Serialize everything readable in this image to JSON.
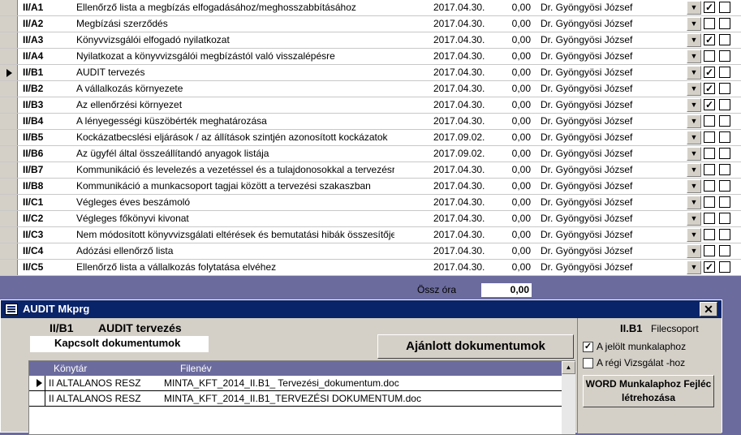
{
  "rows": [
    {
      "code": "II/A1",
      "title": "Ellenőrző lista a megbízás elfogadásához/meghosszabbításához",
      "date": "2017.04.30.",
      "hours": "0,00",
      "person": "Dr. Gyöngyösi József",
      "cb1": true,
      "cb2": false,
      "current": false
    },
    {
      "code": "II/A2",
      "title": "Megbízási szerződés",
      "date": "2017.04.30.",
      "hours": "0,00",
      "person": "Dr. Gyöngyösi József",
      "cb1": false,
      "cb2": false,
      "current": false
    },
    {
      "code": "II/A3",
      "title": "Könyvvizsgálói elfogadó nyilatkozat",
      "date": "2017.04.30.",
      "hours": "0,00",
      "person": "Dr. Gyöngyösi József",
      "cb1": true,
      "cb2": false,
      "current": false
    },
    {
      "code": "II/A4",
      "title": "Nyilatkozat a könyvvizsgálói megbízástól való visszalépésre",
      "date": "2017.04.30.",
      "hours": "0,00",
      "person": "Dr. Gyöngyösi József",
      "cb1": false,
      "cb2": false,
      "current": false
    },
    {
      "code": "II/B1",
      "title": "AUDIT tervezés",
      "date": "2017.04.30.",
      "hours": "0,00",
      "person": "Dr. Gyöngyösi József",
      "cb1": true,
      "cb2": false,
      "current": true
    },
    {
      "code": "II/B2",
      "title": "A vállalkozás környezete",
      "date": "2017.04.30.",
      "hours": "0,00",
      "person": "Dr. Gyöngyösi József",
      "cb1": true,
      "cb2": false,
      "current": false
    },
    {
      "code": "II/B3",
      "title": "Az ellenőrzési környezet",
      "date": "2017.04.30.",
      "hours": "0,00",
      "person": "Dr. Gyöngyösi József",
      "cb1": true,
      "cb2": false,
      "current": false
    },
    {
      "code": "II/B4",
      "title": "A lényegességi küszöbérték meghatározása",
      "date": "2017.04.30.",
      "hours": "0,00",
      "person": "Dr. Gyöngyösi József",
      "cb1": false,
      "cb2": false,
      "current": false
    },
    {
      "code": "II/B5",
      "title": "Kockázatbecslési eljárások / az állítások szintjén azonosított kockázatok",
      "date": "2017.09.02.",
      "hours": "0,00",
      "person": "Dr. Gyöngyösi József",
      "cb1": false,
      "cb2": false,
      "current": false
    },
    {
      "code": "II/B6",
      "title": "Az ügyfél által összeállítandó anyagok listája",
      "date": "2017.09.02.",
      "hours": "0,00",
      "person": "Dr. Gyöngyösi József",
      "cb1": false,
      "cb2": false,
      "current": false
    },
    {
      "code": "II/B7",
      "title": "Kommunikáció és levelezés a vezetéssel és a tulajdonosokkal a tervezésről",
      "date": "2017.04.30.",
      "hours": "0,00",
      "person": "Dr. Gyöngyösi József",
      "cb1": false,
      "cb2": false,
      "current": false
    },
    {
      "code": "II/B8",
      "title": "Kommunikáció a munkacsoport tagjai között a tervezési szakaszban",
      "date": "2017.04.30.",
      "hours": "0,00",
      "person": "Dr. Gyöngyösi József",
      "cb1": false,
      "cb2": false,
      "current": false
    },
    {
      "code": "II/C1",
      "title": "Végleges éves beszámoló",
      "date": "2017.04.30.",
      "hours": "0,00",
      "person": "Dr. Gyöngyösi József",
      "cb1": false,
      "cb2": false,
      "current": false
    },
    {
      "code": "II/C2",
      "title": "Végleges főkönyvi kivonat",
      "date": "2017.04.30.",
      "hours": "0,00",
      "person": "Dr. Gyöngyösi József",
      "cb1": false,
      "cb2": false,
      "current": false
    },
    {
      "code": "II/C3",
      "title": "Nem módosított könyvvizsgálati eltérések és bemutatási hibák összesítője",
      "date": "2017.04.30.",
      "hours": "0,00",
      "person": "Dr. Gyöngyösi József",
      "cb1": false,
      "cb2": false,
      "current": false
    },
    {
      "code": "II/C4",
      "title": "Adózási ellenőrző lista",
      "date": "2017.04.30.",
      "hours": "0,00",
      "person": "Dr. Gyöngyösi József",
      "cb1": false,
      "cb2": false,
      "current": false
    },
    {
      "code": "II/C5",
      "title": "Ellenőrző lista a vállalkozás folytatása elvéhez",
      "date": "2017.04.30.",
      "hours": "0,00",
      "person": "Dr. Gyöngyösi József",
      "cb1": true,
      "cb2": false,
      "current": false
    }
  ],
  "summary": {
    "label": "Össz óra",
    "value": "0,00"
  },
  "window": {
    "title": "AUDIT Mkprg",
    "close": "✕",
    "code": "II/B1",
    "doc_title": "AUDIT tervezés",
    "related_tab": "Kapcsolt dokumentumok",
    "recommended_button": "Ajánlott dokumentumok",
    "list_headers": {
      "folder": "Könytár",
      "filename": "Filenév"
    },
    "files": [
      {
        "folder": "II ALTALANOS RESZ",
        "filename": "MINTA_KFT_2014_II.B1_ Tervezési_dokumentum.doc",
        "current": true
      },
      {
        "folder": "II ALTALANOS RESZ",
        "filename": "MINTA_KFT_2014_II.B1_TERVEZÉSI DOKUMENTUM.doc",
        "current": false
      }
    ],
    "filegroup_code": "II.B1",
    "filegroup_label": "Filecsoport",
    "option_marked": "A jelölt munkalaphoz",
    "option_marked_checked": true,
    "option_old": "A régi Vizsgálat -hoz",
    "option_old_checked": false,
    "word_button": "WORD Munkalaphoz Fejléc létrehozása"
  },
  "icons": {
    "dropdown": "dropdown-arrow-icon",
    "check": "check-icon",
    "scroll_up": "scroll-up-icon"
  }
}
